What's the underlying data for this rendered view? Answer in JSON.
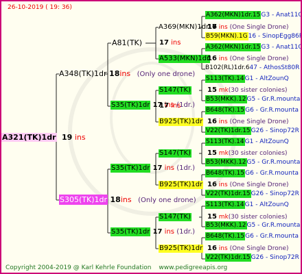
{
  "header": {
    "date": "26-10-2019 ( 19: 36)"
  },
  "footer": {
    "copyright": "Copyright 2004-2019 @ Karl Kehrle Foundation",
    "url": "www.pedigreeapis.org"
  },
  "root": {
    "label": "A321(TK)1dr",
    "inbreed_num": "19",
    "inbreed_unit": "ins"
  },
  "gen1": [
    {
      "label": "A348(TK)1dr",
      "num": "18",
      "unit": "ins",
      "note": "(Only one drone)"
    },
    {
      "label": "S305(TK)1dr",
      "num": "18",
      "unit": "ins",
      "note": "(Only one drone)"
    }
  ],
  "gen2": [
    {
      "label": "A81(TK)",
      "num": "",
      "unit": "",
      "note": ""
    },
    {
      "label": "S35(TK)1dr",
      "num": "17",
      "unit": "ins",
      "note": "(1dr.)"
    },
    {
      "label": "S35(TK)1dr",
      "num": "17",
      "unit": "ins",
      "note": "(1dr.)"
    },
    {
      "label": "S35(TK)1dr",
      "num": "17",
      "unit": "ins",
      "note": "(1dr.)"
    }
  ],
  "gen3": [
    {
      "label": "A369(MKN)1dr",
      "num": "17",
      "unit": "ins",
      "note": ""
    },
    {
      "label": "A533(MKN)1dr",
      "num": "16",
      "unit": "ins",
      "note": "(One Single Drone)"
    },
    {
      "label": "S147(TK)",
      "num": "15",
      "unit": "mk",
      "note": "(30 sister colonies)"
    },
    {
      "label": "B925(TK)1dr",
      "num": "16",
      "unit": "ins",
      "note": "(One Single Drone)"
    },
    {
      "label": "S147(TK)",
      "num": "15",
      "unit": "mk",
      "note": "(30 sister colonies)"
    },
    {
      "label": "B925(TK)1dr",
      "num": "16",
      "unit": "ins",
      "note": "(One Single Drone)"
    },
    {
      "label": "S147(TK)",
      "num": "15",
      "unit": "mk",
      "note": "(30 sister colonies)"
    },
    {
      "label": "B925(TK)1dr",
      "num": "16",
      "unit": "ins",
      "note": "(One Single Drone)"
    }
  ],
  "gen4": [
    {
      "label": "A362(MKN)1dr.15",
      "right": "G3 - Anat11Q"
    },
    {
      "label": "B59(MKN).1G",
      "right": "16 - SinopEgg86R"
    },
    {
      "label": "A362(MKN)1dr.15",
      "right": "G3 - Anat11Q"
    },
    {
      "label": "B102(RL)1dr.6",
      "right": "47 - AthosSt80R"
    },
    {
      "label": "S113(TK).14",
      "right": "G1 - AltZounQ"
    },
    {
      "label": "B53(MKK).12",
      "right": "G5 - Gr.R.mounta"
    },
    {
      "label": "B648(TK).15",
      "right": "G6 - Gr.R.mounta"
    },
    {
      "label": "V22(TK)1dr.15",
      "right": "G26 - Sinop72R"
    },
    {
      "label": "S113(TK).14",
      "right": "G1 - AltZounQ"
    },
    {
      "label": "B53(MKK).12",
      "right": "G5 - Gr.R.mounta"
    },
    {
      "label": "B648(TK).15",
      "right": "G6 - Gr.R.mounta"
    },
    {
      "label": "V22(TK)1dr.15",
      "right": "G26 - Sinop72R"
    },
    {
      "label": "S113(TK).14",
      "right": "G1 - AltZounQ"
    },
    {
      "label": "B53(MKK).12",
      "right": "G5 - Gr.R.mounta"
    },
    {
      "label": "B648(TK).15",
      "right": "G6 - Gr.R.mounta"
    },
    {
      "label": "V22(TK)1dr.15",
      "right": "G26 - Sinop72R"
    }
  ],
  "colors": {
    "border": "#cc0077",
    "green": "#22dd22",
    "yellow": "#ffff22",
    "magenta": "#ee44ee",
    "pink": "#ffccf4",
    "red": "#ee0000",
    "blue": "#1122bb"
  }
}
